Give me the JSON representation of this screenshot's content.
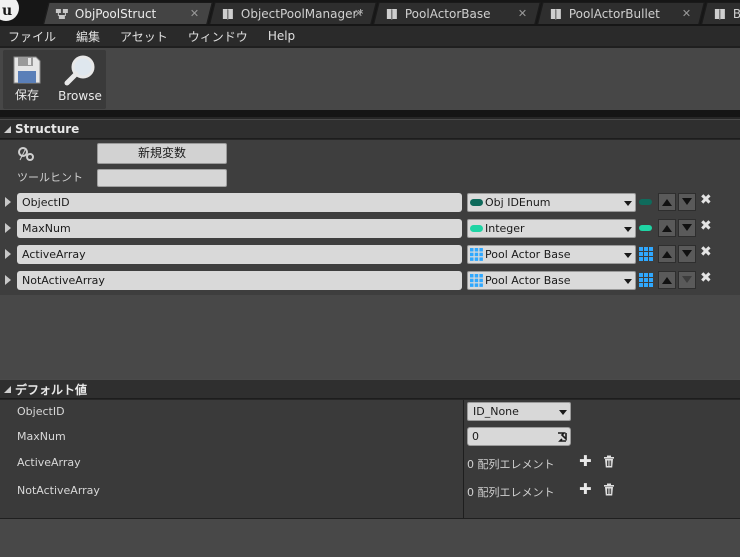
{
  "tabs": [
    {
      "label": "ObjPoolStruct",
      "active": true,
      "icon": "struct-icon",
      "close": "✕"
    },
    {
      "label": "ObjectPoolManager*",
      "active": false,
      "icon": "blueprint-icon",
      "close": "✕"
    },
    {
      "label": "PoolActorBase",
      "active": false,
      "icon": "blueprint-icon",
      "close": "✕"
    },
    {
      "label": "PoolActorBullet",
      "active": false,
      "icon": "blueprint-icon",
      "close": "✕"
    },
    {
      "label": "B",
      "active": false,
      "icon": "blueprint-icon"
    }
  ],
  "menu": [
    "ファイル",
    "編集",
    "アセット",
    "ウィンドウ",
    "Help"
  ],
  "toolbar": {
    "save_label": "保存",
    "browse_label": "Browse"
  },
  "structure": {
    "title": "Structure",
    "new_variable_label": "新規変数",
    "tooltip_label": "ツールヒント",
    "tooltip_value": "",
    "variables": [
      {
        "name": "ObjectID",
        "type": "Obj IDEnum",
        "type_icon": "enum-pill-icon",
        "color": "#0f6b5c",
        "container": "single"
      },
      {
        "name": "MaxNum",
        "type": "Integer",
        "type_icon": "integer-pill-icon",
        "color": "#1fd4a4",
        "container": "single"
      },
      {
        "name": "ActiveArray",
        "type": "Pool Actor Base",
        "type_icon": "array-grid-icon",
        "color": "#2fa8ff",
        "container": "array"
      },
      {
        "name": "NotActiveArray",
        "type": "Pool Actor Base",
        "type_icon": "array-grid-icon",
        "color": "#2fa8ff",
        "container": "array"
      }
    ],
    "remove_glyph": "✖"
  },
  "defaults": {
    "title": "デフォルト値",
    "rows": [
      {
        "label": "ObjectID",
        "value": "ID_None"
      },
      {
        "label": "MaxNum",
        "value": "0"
      },
      {
        "label": "ActiveArray",
        "value": "0 配列エレメント"
      },
      {
        "label": "NotActiveArray",
        "value": "0 配列エレメント"
      }
    ],
    "add_glyph": "✚"
  }
}
